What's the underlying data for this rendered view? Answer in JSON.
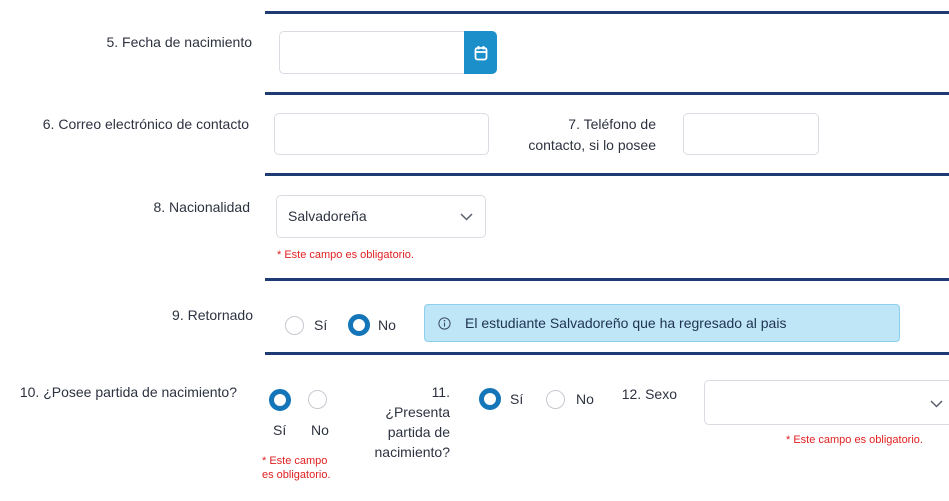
{
  "q5": {
    "label": "5. Fecha de nacimiento",
    "value": "",
    "calendar_icon": "calendar-icon"
  },
  "q6": {
    "label": "6. Correo electrónico de contacto",
    "value": ""
  },
  "q7": {
    "label_line1": "7. Teléfono de",
    "label_line2": "contacto, si lo posee",
    "value": ""
  },
  "q8": {
    "label": "8. Nacionalidad",
    "selected": "Salvadoreña",
    "error": "* Este campo es obligatorio."
  },
  "q9": {
    "label": "9. Retornado",
    "options": [
      "Sí",
      "No"
    ],
    "selected": "No",
    "info_icon": "info-icon",
    "info": "El estudiante Salvadoreño que ha regresado al pais"
  },
  "q10": {
    "label": "10. ¿Posee partida de nacimiento?",
    "options": [
      "Sí",
      "No"
    ],
    "selected": "Sí",
    "error_line1": "* Este campo",
    "error_line2": "es obligatorio."
  },
  "q11": {
    "label_lines": [
      "11.",
      "¿Presenta",
      "partida de",
      "nacimiento?"
    ],
    "options": [
      "Sí",
      "No"
    ],
    "selected": "Sí"
  },
  "q12": {
    "label": "12. Sexo",
    "selected": "",
    "error": "* Este campo es obligatorio."
  },
  "colors": {
    "accent": "#1476b8",
    "rule": "#1f3b73",
    "error": "#e02020",
    "info_bg": "#bfe6f7"
  }
}
